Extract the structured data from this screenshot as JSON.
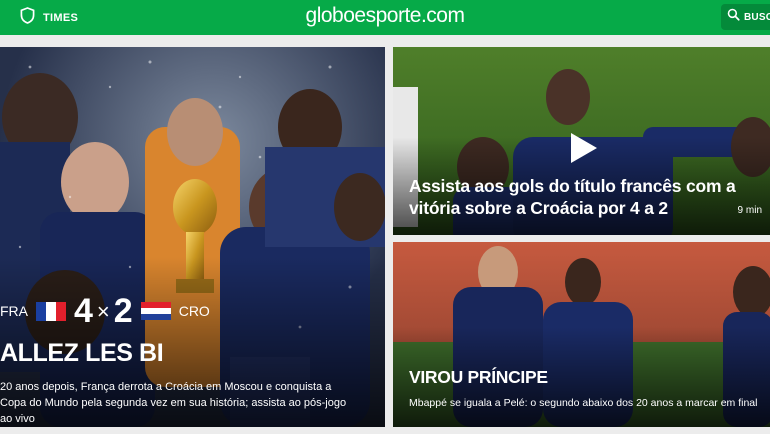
{
  "header": {
    "times_label": "TIMES",
    "brand": "globoesporte.com",
    "search_label": "BUSCA",
    "bg_color": "#06aa48"
  },
  "main_story": {
    "home_team": "FRA",
    "home_score": "4",
    "separator": "×",
    "away_score": "2",
    "away_team": "CRO",
    "headline": "ALLEZ LES BI",
    "summary": "20 anos depois, França derrota a Croácia em Moscou e conquista a Copa do Mundo pela segunda vez em sua história; assista ao pós-jogo ao vivo"
  },
  "video_story": {
    "title": "Assista aos gols do título francês com a vitória sobre a Croácia por 4 a 2",
    "duration": "9 min",
    "icon": "play-icon"
  },
  "side_story": {
    "title": "VIROU PRÍNCIPE",
    "summary": "Mbappé se iguala a Pelé: o segundo abaixo dos 20 anos a marcar em final"
  }
}
